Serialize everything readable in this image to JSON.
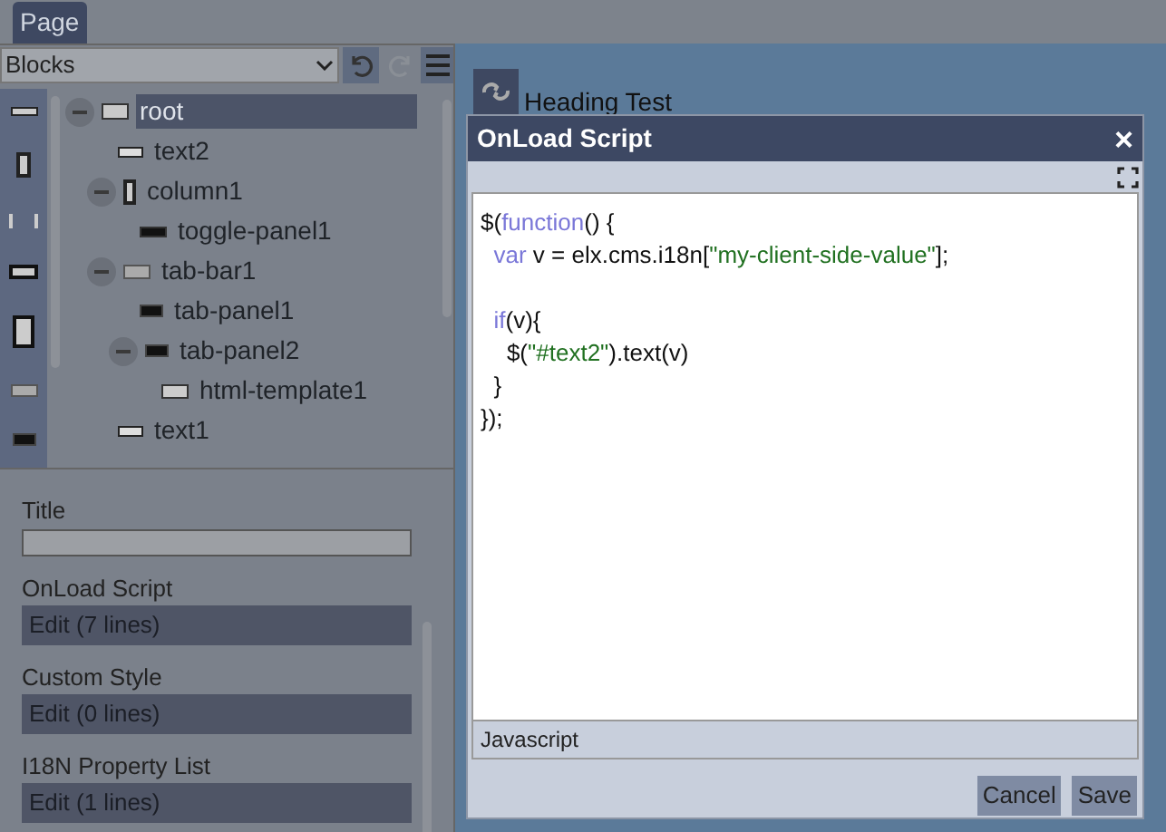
{
  "tabs": [
    {
      "label": "Page",
      "selected": true
    }
  ],
  "block_select": {
    "value": "Blocks"
  },
  "tree": [
    {
      "label": "root",
      "kind": "page",
      "expanded": true,
      "selected": true,
      "children": [
        {
          "label": "text2",
          "kind": "text",
          "selected": false
        },
        {
          "label": "column1",
          "kind": "column",
          "expanded": true,
          "selected": false,
          "children": [
            {
              "label": "toggle-panel1",
              "kind": "toggle",
              "selected": false
            }
          ]
        },
        {
          "label": "tab-bar1",
          "kind": "tabbar",
          "expanded": true,
          "selected": false,
          "children": [
            {
              "label": "tab-panel1",
              "kind": "tab",
              "selected": false
            },
            {
              "label": "tab-panel2",
              "kind": "tab",
              "expanded": true,
              "selected": false,
              "children": [
                {
                  "label": "html-template1",
                  "kind": "html",
                  "selected": false
                }
              ]
            }
          ]
        },
        {
          "label": "text1",
          "kind": "text",
          "selected": false
        }
      ]
    }
  ],
  "properties": [
    {
      "label": "Title",
      "kind": "input"
    },
    {
      "label": "OnLoad Script",
      "kind": "edit",
      "value": "Edit (7 lines)"
    },
    {
      "label": "Custom Style",
      "kind": "edit",
      "value": "Edit (0 lines)"
    },
    {
      "label": "I18N Property List",
      "kind": "edit",
      "value": "Edit (1 lines)"
    }
  ],
  "preview": {
    "heading": "Heading Test"
  },
  "dialog": {
    "title": "OnLoad Script",
    "close": "×",
    "code": [
      {
        "blank_before": false,
        "tokens": [
          {
            "kind": "plain",
            "text": "$("
          },
          {
            "kind": "keyword",
            "text": "function"
          },
          {
            "kind": "plain",
            "text": "() {"
          }
        ]
      },
      {
        "blank_before": false,
        "tokens": [
          {
            "kind": "keyword",
            "text": "  var"
          },
          {
            "kind": "plain",
            "text": " v = elx.cms.i18n["
          },
          {
            "kind": "string",
            "text": "\"my-client-side-value\""
          },
          {
            "kind": "plain",
            "text": "];"
          }
        ]
      },
      {
        "blank_before": true,
        "tokens": [
          {
            "kind": "keyword",
            "text": "  if"
          },
          {
            "kind": "plain",
            "text": "(v){"
          }
        ]
      },
      {
        "blank_before": false,
        "tokens": [
          {
            "kind": "plain",
            "text": "    $("
          },
          {
            "kind": "string",
            "text": "\"#text2\""
          },
          {
            "kind": "plain",
            "text": ").text(v)"
          }
        ]
      },
      {
        "blank_before": false,
        "tokens": [
          {
            "kind": "plain",
            "text": "  }"
          }
        ]
      },
      {
        "blank_before": false,
        "tokens": [
          {
            "kind": "plain",
            "text": "});"
          }
        ]
      }
    ],
    "language": "Javascript",
    "buttons": [
      "Cancel",
      "Save"
    ]
  }
}
